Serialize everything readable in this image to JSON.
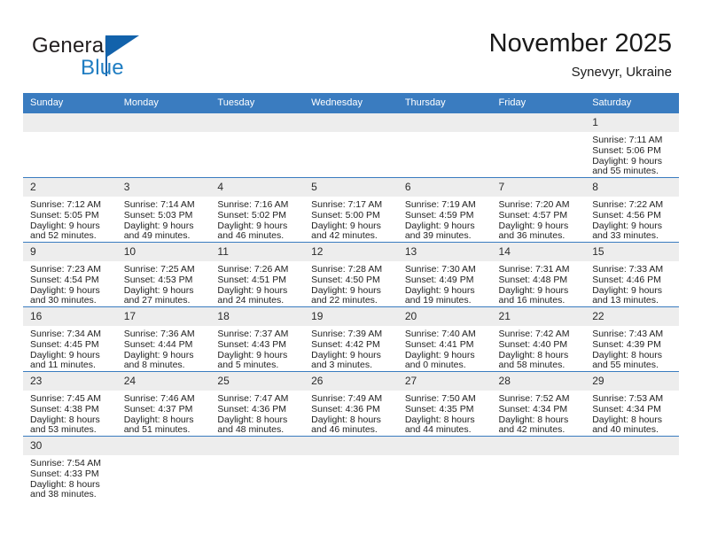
{
  "brand": {
    "name_top": "General",
    "name_bottom": "Blue",
    "logo_color": "#1262ab",
    "text_color": "#1f7dc2"
  },
  "header": {
    "title": "November 2025",
    "subtitle": "Synevyr, Ukraine",
    "accent_color": "#3a7cc0",
    "daynum_bg": "#ededed"
  },
  "weekdays": [
    "Sunday",
    "Monday",
    "Tuesday",
    "Wednesday",
    "Thursday",
    "Friday",
    "Saturday"
  ],
  "weeks": [
    [
      {
        "day": "",
        "blank": true
      },
      {
        "day": "",
        "blank": true
      },
      {
        "day": "",
        "blank": true
      },
      {
        "day": "",
        "blank": true
      },
      {
        "day": "",
        "blank": true
      },
      {
        "day": "",
        "blank": true
      },
      {
        "day": "1",
        "sunrise": "Sunrise: 7:11 AM",
        "sunset": "Sunset: 5:06 PM",
        "daylight1": "Daylight: 9 hours",
        "daylight2": "and 55 minutes."
      }
    ],
    [
      {
        "day": "2",
        "sunrise": "Sunrise: 7:12 AM",
        "sunset": "Sunset: 5:05 PM",
        "daylight1": "Daylight: 9 hours",
        "daylight2": "and 52 minutes."
      },
      {
        "day": "3",
        "sunrise": "Sunrise: 7:14 AM",
        "sunset": "Sunset: 5:03 PM",
        "daylight1": "Daylight: 9 hours",
        "daylight2": "and 49 minutes."
      },
      {
        "day": "4",
        "sunrise": "Sunrise: 7:16 AM",
        "sunset": "Sunset: 5:02 PM",
        "daylight1": "Daylight: 9 hours",
        "daylight2": "and 46 minutes."
      },
      {
        "day": "5",
        "sunrise": "Sunrise: 7:17 AM",
        "sunset": "Sunset: 5:00 PM",
        "daylight1": "Daylight: 9 hours",
        "daylight2": "and 42 minutes."
      },
      {
        "day": "6",
        "sunrise": "Sunrise: 7:19 AM",
        "sunset": "Sunset: 4:59 PM",
        "daylight1": "Daylight: 9 hours",
        "daylight2": "and 39 minutes."
      },
      {
        "day": "7",
        "sunrise": "Sunrise: 7:20 AM",
        "sunset": "Sunset: 4:57 PM",
        "daylight1": "Daylight: 9 hours",
        "daylight2": "and 36 minutes."
      },
      {
        "day": "8",
        "sunrise": "Sunrise: 7:22 AM",
        "sunset": "Sunset: 4:56 PM",
        "daylight1": "Daylight: 9 hours",
        "daylight2": "and 33 minutes."
      }
    ],
    [
      {
        "day": "9",
        "sunrise": "Sunrise: 7:23 AM",
        "sunset": "Sunset: 4:54 PM",
        "daylight1": "Daylight: 9 hours",
        "daylight2": "and 30 minutes."
      },
      {
        "day": "10",
        "sunrise": "Sunrise: 7:25 AM",
        "sunset": "Sunset: 4:53 PM",
        "daylight1": "Daylight: 9 hours",
        "daylight2": "and 27 minutes."
      },
      {
        "day": "11",
        "sunrise": "Sunrise: 7:26 AM",
        "sunset": "Sunset: 4:51 PM",
        "daylight1": "Daylight: 9 hours",
        "daylight2": "and 24 minutes."
      },
      {
        "day": "12",
        "sunrise": "Sunrise: 7:28 AM",
        "sunset": "Sunset: 4:50 PM",
        "daylight1": "Daylight: 9 hours",
        "daylight2": "and 22 minutes."
      },
      {
        "day": "13",
        "sunrise": "Sunrise: 7:30 AM",
        "sunset": "Sunset: 4:49 PM",
        "daylight1": "Daylight: 9 hours",
        "daylight2": "and 19 minutes."
      },
      {
        "day": "14",
        "sunrise": "Sunrise: 7:31 AM",
        "sunset": "Sunset: 4:48 PM",
        "daylight1": "Daylight: 9 hours",
        "daylight2": "and 16 minutes."
      },
      {
        "day": "15",
        "sunrise": "Sunrise: 7:33 AM",
        "sunset": "Sunset: 4:46 PM",
        "daylight1": "Daylight: 9 hours",
        "daylight2": "and 13 minutes."
      }
    ],
    [
      {
        "day": "16",
        "sunrise": "Sunrise: 7:34 AM",
        "sunset": "Sunset: 4:45 PM",
        "daylight1": "Daylight: 9 hours",
        "daylight2": "and 11 minutes."
      },
      {
        "day": "17",
        "sunrise": "Sunrise: 7:36 AM",
        "sunset": "Sunset: 4:44 PM",
        "daylight1": "Daylight: 9 hours",
        "daylight2": "and 8 minutes."
      },
      {
        "day": "18",
        "sunrise": "Sunrise: 7:37 AM",
        "sunset": "Sunset: 4:43 PM",
        "daylight1": "Daylight: 9 hours",
        "daylight2": "and 5 minutes."
      },
      {
        "day": "19",
        "sunrise": "Sunrise: 7:39 AM",
        "sunset": "Sunset: 4:42 PM",
        "daylight1": "Daylight: 9 hours",
        "daylight2": "and 3 minutes."
      },
      {
        "day": "20",
        "sunrise": "Sunrise: 7:40 AM",
        "sunset": "Sunset: 4:41 PM",
        "daylight1": "Daylight: 9 hours",
        "daylight2": "and 0 minutes."
      },
      {
        "day": "21",
        "sunrise": "Sunrise: 7:42 AM",
        "sunset": "Sunset: 4:40 PM",
        "daylight1": "Daylight: 8 hours",
        "daylight2": "and 58 minutes."
      },
      {
        "day": "22",
        "sunrise": "Sunrise: 7:43 AM",
        "sunset": "Sunset: 4:39 PM",
        "daylight1": "Daylight: 8 hours",
        "daylight2": "and 55 minutes."
      }
    ],
    [
      {
        "day": "23",
        "sunrise": "Sunrise: 7:45 AM",
        "sunset": "Sunset: 4:38 PM",
        "daylight1": "Daylight: 8 hours",
        "daylight2": "and 53 minutes."
      },
      {
        "day": "24",
        "sunrise": "Sunrise: 7:46 AM",
        "sunset": "Sunset: 4:37 PM",
        "daylight1": "Daylight: 8 hours",
        "daylight2": "and 51 minutes."
      },
      {
        "day": "25",
        "sunrise": "Sunrise: 7:47 AM",
        "sunset": "Sunset: 4:36 PM",
        "daylight1": "Daylight: 8 hours",
        "daylight2": "and 48 minutes."
      },
      {
        "day": "26",
        "sunrise": "Sunrise: 7:49 AM",
        "sunset": "Sunset: 4:36 PM",
        "daylight1": "Daylight: 8 hours",
        "daylight2": "and 46 minutes."
      },
      {
        "day": "27",
        "sunrise": "Sunrise: 7:50 AM",
        "sunset": "Sunset: 4:35 PM",
        "daylight1": "Daylight: 8 hours",
        "daylight2": "and 44 minutes."
      },
      {
        "day": "28",
        "sunrise": "Sunrise: 7:52 AM",
        "sunset": "Sunset: 4:34 PM",
        "daylight1": "Daylight: 8 hours",
        "daylight2": "and 42 minutes."
      },
      {
        "day": "29",
        "sunrise": "Sunrise: 7:53 AM",
        "sunset": "Sunset: 4:34 PM",
        "daylight1": "Daylight: 8 hours",
        "daylight2": "and 40 minutes."
      }
    ],
    [
      {
        "day": "30",
        "sunrise": "Sunrise: 7:54 AM",
        "sunset": "Sunset: 4:33 PM",
        "daylight1": "Daylight: 8 hours",
        "daylight2": "and 38 minutes."
      },
      {
        "day": "",
        "blank": true
      },
      {
        "day": "",
        "blank": true
      },
      {
        "day": "",
        "blank": true
      },
      {
        "day": "",
        "blank": true
      },
      {
        "day": "",
        "blank": true
      },
      {
        "day": "",
        "blank": true
      }
    ]
  ]
}
